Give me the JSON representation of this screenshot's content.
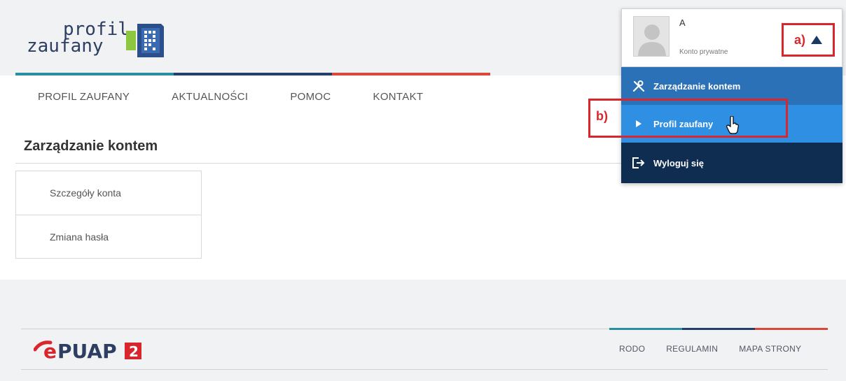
{
  "header": {
    "logo": {
      "line1": "profil",
      "line2": "zaufany"
    }
  },
  "nav": [
    {
      "label": "PROFIL ZAUFANY"
    },
    {
      "label": "AKTUALNOŚCI"
    },
    {
      "label": "POMOC"
    },
    {
      "label": "KONTAKT"
    }
  ],
  "page": {
    "title": "Zarządzanie kontem",
    "side_menu": [
      {
        "label": "Szczegóły konta"
      },
      {
        "label": "Zmiana hasła"
      }
    ]
  },
  "account": {
    "name": "A",
    "type": "Konto prywatne",
    "toggle_annotation": "a)",
    "menu": {
      "manage": "Zarządzanie kontem",
      "profile": "Profil zaufany",
      "logout": "Wyloguj się"
    },
    "profile_annotation": "b)"
  },
  "footer": {
    "logo": {
      "text": "ePUAP",
      "badge": "2"
    },
    "links": [
      {
        "label": "RODO"
      },
      {
        "label": "REGULAMIN"
      },
      {
        "label": "MAPA STRONY"
      }
    ]
  },
  "colors": {
    "accent_blue": "#2b71b8",
    "accent_light_blue": "#2f8fe2",
    "dark_navy": "#0f2d50",
    "annotation_red": "#d9262c",
    "bar_teal": "#2a8fa0",
    "bar_navy": "#24406a",
    "bar_red": "#d9483b"
  }
}
